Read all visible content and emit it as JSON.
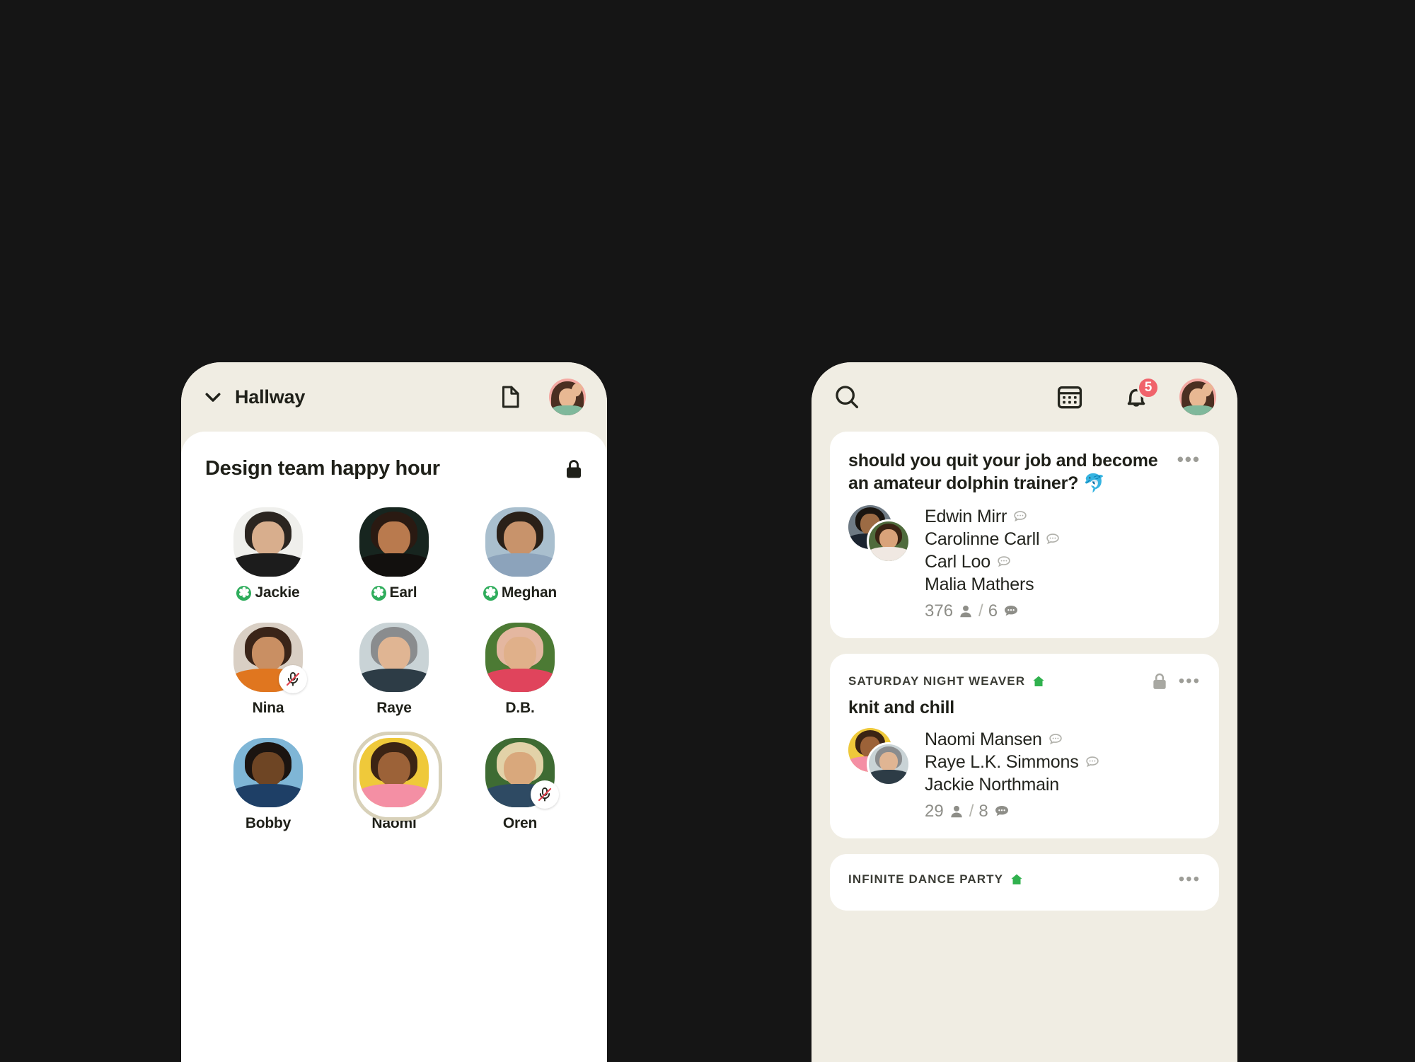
{
  "theme": {
    "page_bg": "#151515",
    "phone_bg": "#F0EDE3",
    "card_bg": "#FFFFFF",
    "text": "#1F2019",
    "muted": "#8E8E88",
    "accent_green": "#2FAD5C",
    "badge_red": "#F0636B",
    "speaking_ring": "#D8D1B9"
  },
  "left_phone": {
    "topbar": {
      "chevron_icon": "chevron-down-icon",
      "title": "Hallway",
      "notes_icon": "document-icon",
      "avatar_icon": "user-avatar"
    },
    "room": {
      "title": "Design team happy hour",
      "lock_icon": "lock-icon",
      "people": [
        {
          "name": "Jackie",
          "new_badge": true,
          "muted": false,
          "speaking": false
        },
        {
          "name": "Earl",
          "new_badge": true,
          "muted": false,
          "speaking": false
        },
        {
          "name": "Meghan",
          "new_badge": true,
          "muted": false,
          "speaking": false
        },
        {
          "name": "Nina",
          "new_badge": false,
          "muted": true,
          "speaking": false
        },
        {
          "name": "Raye",
          "new_badge": false,
          "muted": false,
          "speaking": false
        },
        {
          "name": "D.B.",
          "new_badge": false,
          "muted": false,
          "speaking": false
        },
        {
          "name": "Bobby",
          "new_badge": false,
          "muted": false,
          "speaking": false
        },
        {
          "name": "Naomi",
          "new_badge": false,
          "muted": false,
          "speaking": true
        },
        {
          "name": "Oren",
          "new_badge": false,
          "muted": true,
          "speaking": false
        }
      ]
    }
  },
  "right_phone": {
    "topbar": {
      "search_icon": "search-icon",
      "calendar_icon": "calendar-icon",
      "bell_icon": "bell-icon",
      "bell_badge": "5",
      "avatar_icon": "user-avatar"
    },
    "feed": [
      {
        "kicker": "",
        "has_house": false,
        "locked": false,
        "title_line1": "should you quit your job and become",
        "title_line2": "an amateur dolphin trainer? 🐬",
        "menu_icon": "more-options-icon",
        "speakers": [
          {
            "name": "Edwin Mirr",
            "chat": true
          },
          {
            "name": "Carolinne Carll",
            "chat": true
          },
          {
            "name": "Carl Loo",
            "chat": true
          },
          {
            "name": "Malia Mathers",
            "chat": false
          }
        ],
        "listeners": "376",
        "separator": "/",
        "speaker_count": "6"
      },
      {
        "kicker": "SATURDAY NIGHT WEAVER",
        "has_house": true,
        "locked": true,
        "title_line1": "knit and chill",
        "title_line2": "",
        "menu_icon": "more-options-icon",
        "speakers": [
          {
            "name": "Naomi Mansen",
            "chat": true
          },
          {
            "name": "Raye L.K. Simmons",
            "chat": true
          },
          {
            "name": "Jackie Northmain",
            "chat": false
          }
        ],
        "listeners": "29",
        "separator": "/",
        "speaker_count": "8"
      },
      {
        "kicker": "INFINITE DANCE PARTY",
        "has_house": true,
        "locked": false,
        "title_line1": "",
        "title_line2": "",
        "menu_icon": "more-options-icon",
        "speakers": [],
        "listeners": "",
        "separator": "",
        "speaker_count": ""
      }
    ]
  }
}
